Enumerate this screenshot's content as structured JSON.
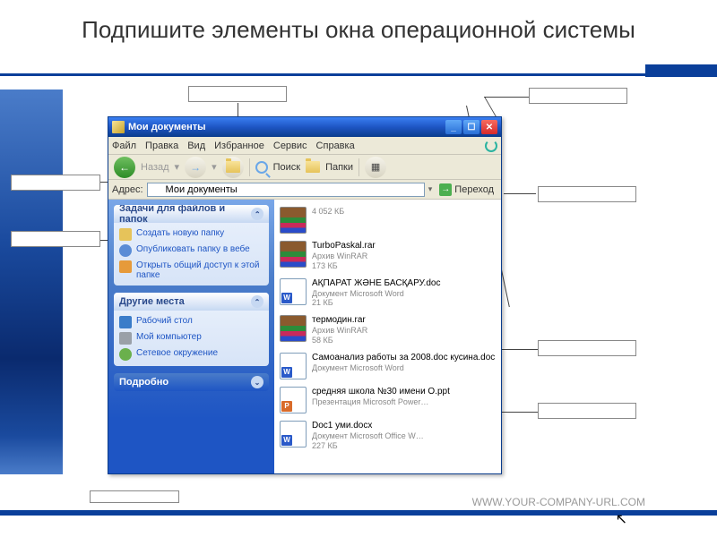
{
  "slide": {
    "title": "Подпишите элементы окна операционной системы",
    "footer": "WWW.YOUR-COMPANY-URL.COM"
  },
  "window": {
    "title": "Мои документы",
    "menu": [
      "Файл",
      "Правка",
      "Вид",
      "Избранное",
      "Сервис",
      "Справка"
    ],
    "toolbar": {
      "back": "Назад",
      "search": "Поиск",
      "folders": "Папки"
    },
    "address": {
      "label": "Адрес:",
      "value": "Мои документы",
      "go": "Переход"
    }
  },
  "sidepane": {
    "tasks": {
      "header": "Задачи для файлов и папок",
      "items": [
        {
          "icon": "#e6c35a",
          "label": "Создать новую папку"
        },
        {
          "icon": "#5a8cd6",
          "label": "Опубликовать папку в вебе"
        },
        {
          "icon": "#e69a3a",
          "label": "Открыть общий доступ к этой папке"
        }
      ]
    },
    "places": {
      "header": "Другие места",
      "items": [
        {
          "icon": "#3a7cc9",
          "label": "Рабочий стол"
        },
        {
          "icon": "#9aa0a8",
          "label": "Мой компьютер"
        },
        {
          "icon": "#6ab04c",
          "label": "Сетевое окружение"
        }
      ]
    },
    "details": {
      "header": "Подробно"
    }
  },
  "files": [
    {
      "type": "rar",
      "name": "",
      "desc": "",
      "size": "4 052 КБ"
    },
    {
      "type": "rar",
      "name": "TurboPaskal.rar",
      "desc": "Архив WinRAR",
      "size": "173 КБ"
    },
    {
      "type": "doc",
      "name": "АҚПАРАТ ЖӘНЕ БАСҚАРУ.doc",
      "desc": "Документ Microsoft Word",
      "size": "21 КБ"
    },
    {
      "type": "rar",
      "name": "термодин.rar",
      "desc": "Архив WinRAR",
      "size": "58 КБ"
    },
    {
      "type": "doc",
      "name": "Самоанализ работы за 2008.doc кусина.doc",
      "desc": "Документ Microsoft Word",
      "size": ""
    },
    {
      "type": "ppt",
      "name": "средняя школа №30 имени О.ppt",
      "desc": "Презентация Microsoft Power…",
      "size": ""
    },
    {
      "type": "docx",
      "name": "Doc1 уми.docx",
      "desc": "Документ Microsoft Office W…",
      "size": "227 КБ"
    }
  ]
}
